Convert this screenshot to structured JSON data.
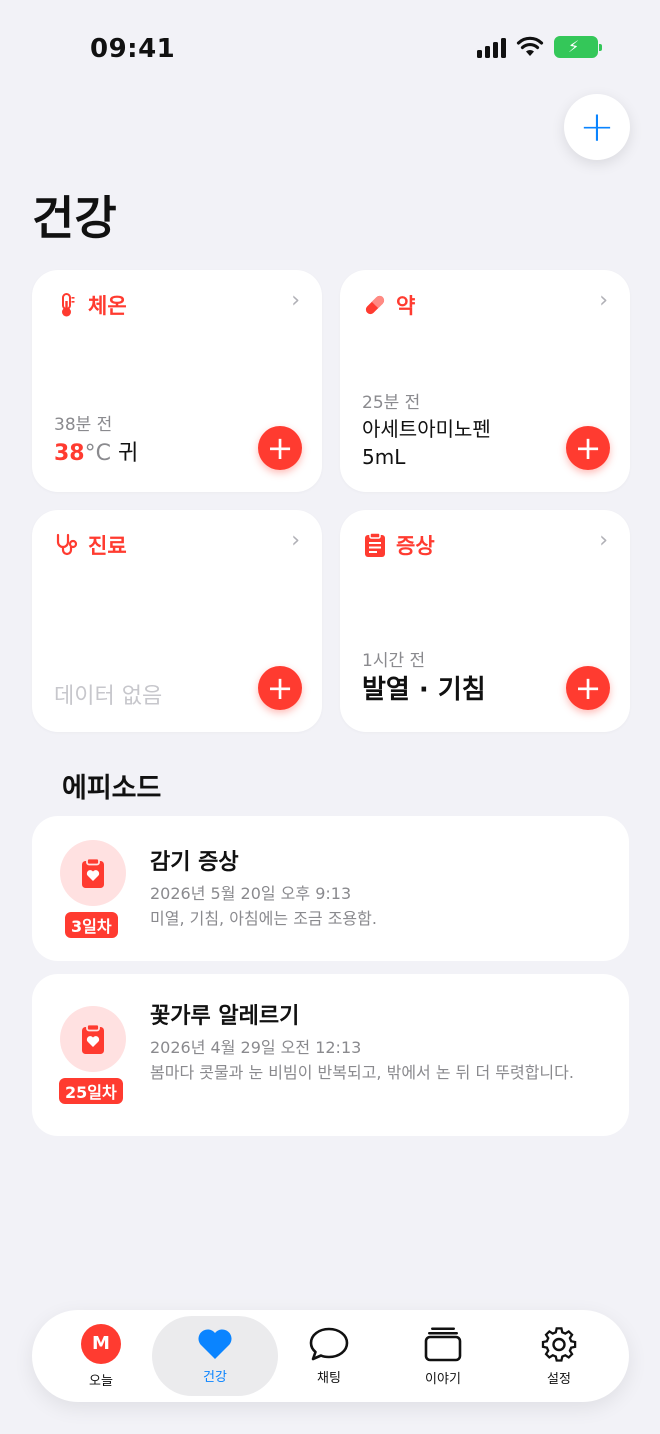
{
  "status": {
    "time": "09:41"
  },
  "header": {
    "title": "건강"
  },
  "cards": {
    "temperature": {
      "label": "체온",
      "ago": "38분 전",
      "value": "38",
      "unit": "°C",
      "site": "귀"
    },
    "medicine": {
      "label": "약",
      "ago": "25분 전",
      "name": "아세트아미노펜",
      "dose": "5mL"
    },
    "visit": {
      "label": "진료",
      "empty": "데이터 없음"
    },
    "symptom": {
      "label": "증상",
      "ago": "1시간 전",
      "value": "발열 · 기침"
    }
  },
  "episodes": {
    "title": "에피소드",
    "items": [
      {
        "badge": "3일차",
        "title": "감기 증상",
        "date": "2026년 5월 20일 오후 9:13",
        "desc": "미열, 기침, 아침에는 조금 조용함."
      },
      {
        "badge": "25일차",
        "title": "꽃가루 알레르기",
        "date": "2026년 4월 29일 오전 12:13",
        "desc": "봄마다 콧물과 눈 비빔이 반복되고, 밖에서 논 뒤 더 뚜렷합니다."
      }
    ]
  },
  "tabs": {
    "avatar_letter": "M",
    "today": "오늘",
    "health": "건강",
    "chat": "채팅",
    "stories": "이야기",
    "settings": "설정"
  },
  "colors": {
    "accent": "#ff3b30",
    "blue": "#0a84ff",
    "background": "#f2f2f7"
  }
}
